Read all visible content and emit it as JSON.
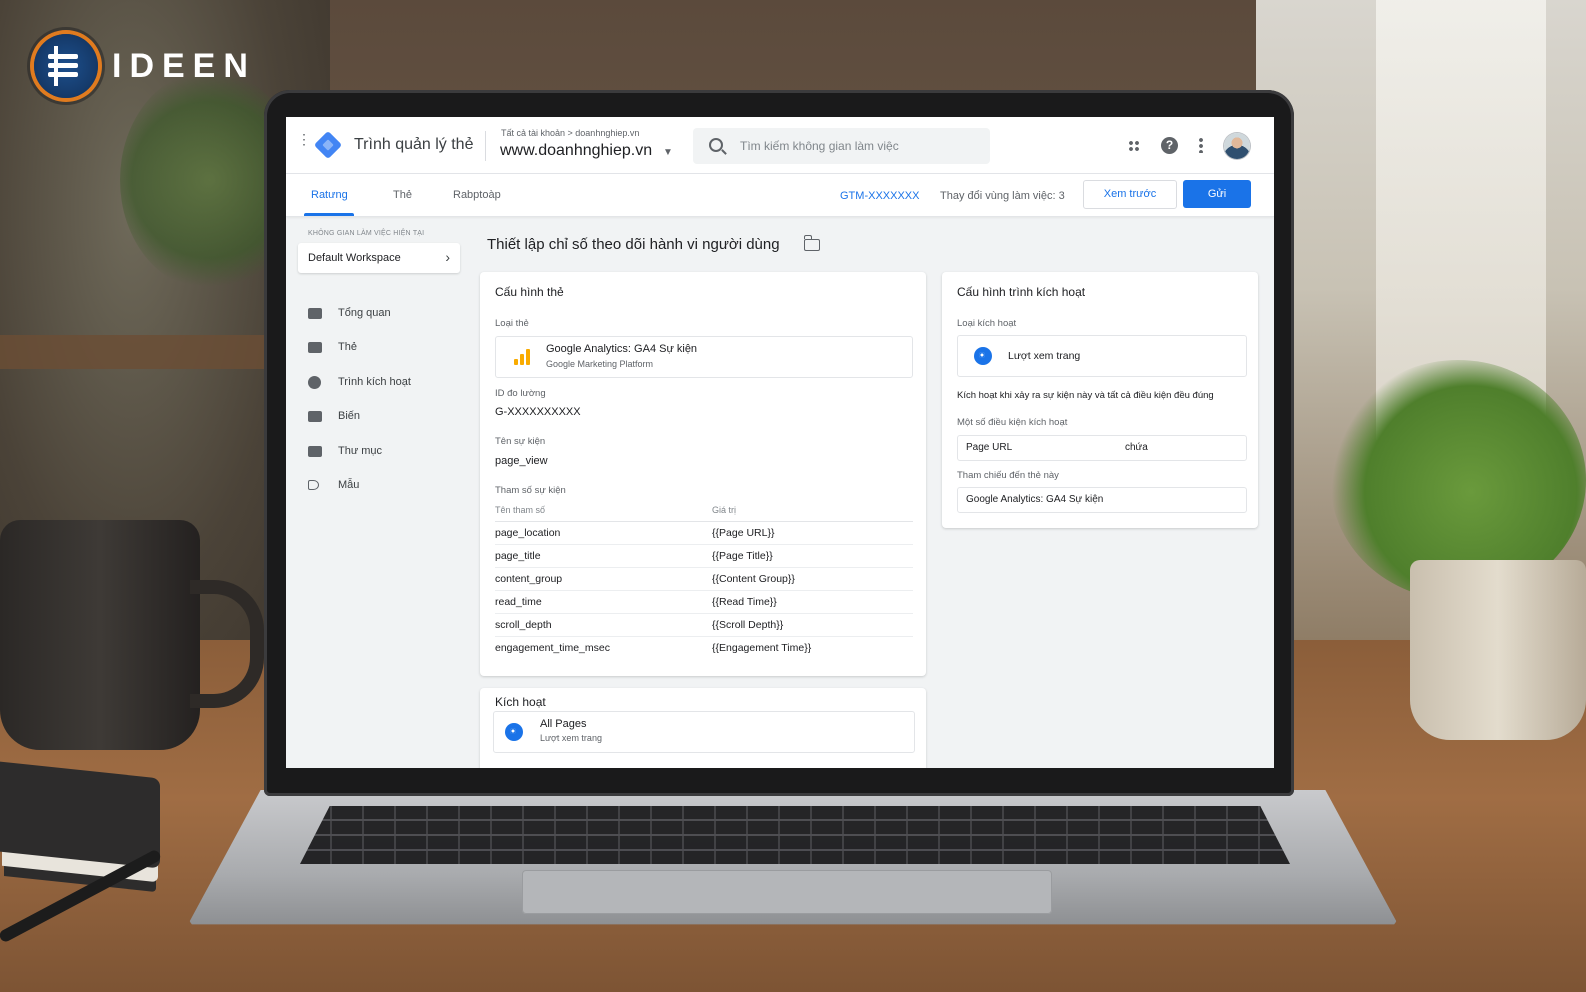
{
  "brand": {
    "name": "IDEEN"
  },
  "app": {
    "title": "Trình quản lý thẻ",
    "breadcrumb": "Tất cả tài khoản > doanhnghiep.vn",
    "container_name": "www.doanhnghiep.vn",
    "search_placeholder": "Tìm kiếm không gian làm việc",
    "icons": [
      "apps-icon",
      "help-icon",
      "more-vert-icon",
      "avatar"
    ]
  },
  "tabs": [
    {
      "label": "Ratưng",
      "active": true
    },
    {
      "label": "Thẻ",
      "active": false
    },
    {
      "label": "Rabptoàp",
      "active": false
    }
  ],
  "toolbar": {
    "container_id": "GTM-XXXXXXX",
    "workspace_changes": "Thay đổi vùng làm việc: 3",
    "preview_label": "Xem trước",
    "submit_label": "Gửi"
  },
  "sidebar": {
    "workspace_label": "KHÔNG GIAN LÀM VIỆC HIỆN TẠI",
    "workspace_name": "Default Workspace",
    "items": [
      {
        "label": "Tổng quan",
        "icon": "briefcase-icon"
      },
      {
        "label": "Thẻ",
        "icon": "tag-folder-icon"
      },
      {
        "label": "Trình kích hoạt",
        "icon": "globe-icon"
      },
      {
        "label": "Biến",
        "icon": "variable-icon"
      },
      {
        "label": "Thư mục",
        "icon": "folder-icon"
      },
      {
        "label": "Mẫu",
        "icon": "label-icon"
      }
    ]
  },
  "main": {
    "page_title": "Thiết lập chỉ số theo dõi hành vi người dùng",
    "tag_config": {
      "title": "Cấu hình thẻ",
      "tag_type_label": "Loại thẻ",
      "tag_type_name": "Google Analytics: GA4 Sự kiện",
      "tag_type_sub": "Google Marketing Platform",
      "measurement_id_label": "ID đo lường",
      "measurement_id": "G-XXXXXXXXXX",
      "event_name_label": "Tên sự kiện",
      "event_name": "page_view",
      "params_label": "Tham số sự kiện",
      "params_col_name": "Tên tham số",
      "params_col_value": "Giá trị",
      "params": [
        {
          "name": "page_location",
          "value": "{{Page URL}}"
        },
        {
          "name": "page_title",
          "value": "{{Page Title}}"
        },
        {
          "name": "content_group",
          "value": "{{Content Group}}"
        },
        {
          "name": "read_time",
          "value": "{{Read Time}}"
        },
        {
          "name": "scroll_depth",
          "value": "{{Scroll Depth}}"
        },
        {
          "name": "engagement_time_msec",
          "value": "{{Engagement Time}}"
        }
      ]
    },
    "activation": {
      "title": "Kích hoạt",
      "trigger_name": "All Pages",
      "trigger_sub": "Lượt xem trang"
    },
    "trigger_config": {
      "title": "Cấu hình trình kích hoạt",
      "type_label": "Loại kích hoạt",
      "type_name": "Lượt xem trang",
      "fires_desc": "Kích hoạt khi xảy ra sự kiện này và tất cả điều kiện đều đúng",
      "conditions_label": "Một số điều kiện kích hoạt",
      "condition_variable": "Page URL",
      "condition_operator": "chứa",
      "reference_label": "Tham chiếu đến thẻ này",
      "reference_value": "Google Analytics: GA4 Sự kiện"
    }
  },
  "colors": {
    "accent": "#1a73e8",
    "ga_orange": "#f9ab00"
  }
}
